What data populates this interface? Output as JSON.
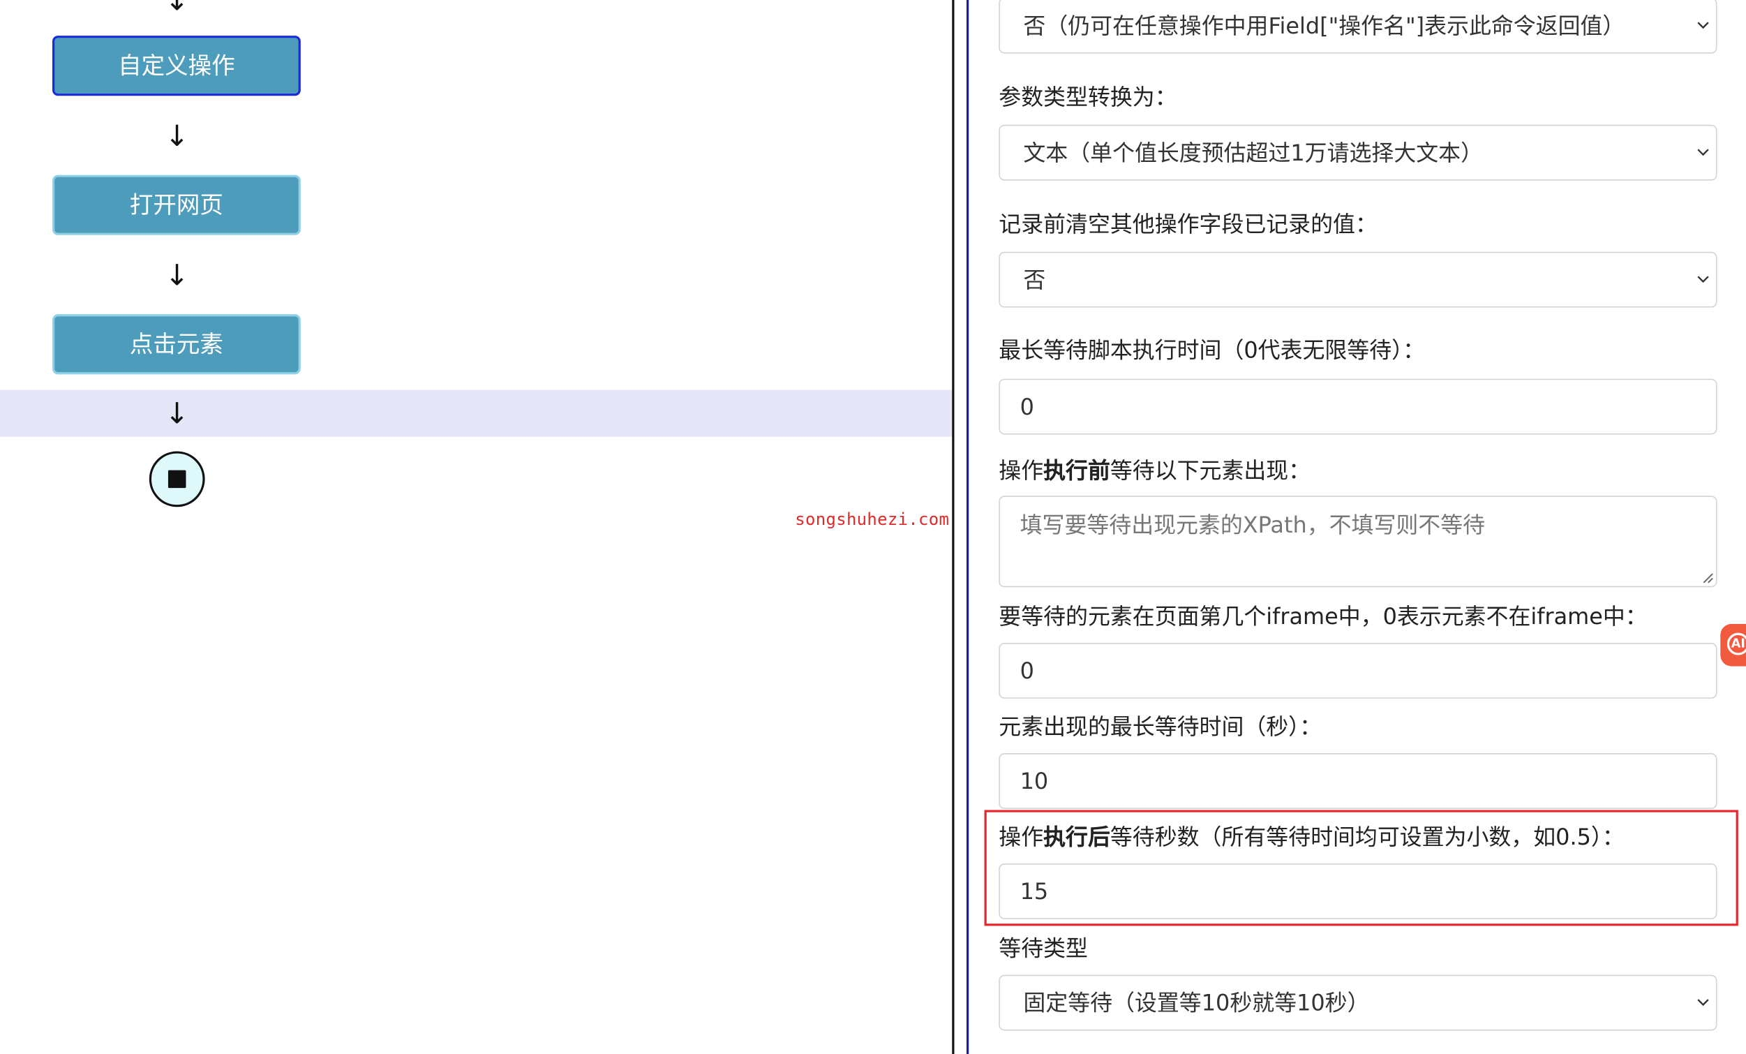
{
  "flow": {
    "arrow": "↓",
    "steps": [
      "自定义操作",
      "打开网页",
      "点击元素"
    ]
  },
  "watermark": "songshuhezi.com",
  "settings": {
    "return_select_value": "否（仍可在任意操作中用Field[\"操作名\"]表示此命令返回值）",
    "param_type_label": "参数类型转换为：",
    "param_type_value": "文本（单个值长度预估超过1万请选择大文本）",
    "clear_label": "记录前清空其他操作字段已记录的值：",
    "clear_value": "否",
    "max_script_wait_label": "最长等待脚本执行时间（0代表无限等待）：",
    "max_script_wait_value": "0",
    "before_label_prefix": "操作",
    "before_label_bold": "执行前",
    "before_label_suffix": "等待以下元素出现：",
    "xpath_placeholder": "填写要等待出现元素的XPath，不填写则不等待",
    "iframe_label": "要等待的元素在页面第几个iframe中，0表示元素不在iframe中：",
    "iframe_value": "0",
    "max_element_wait_label": "元素出现的最长等待时间（秒）：",
    "max_element_wait_value": "10",
    "after_label_prefix": "操作",
    "after_label_bold": "执行后",
    "after_label_suffix": "等待秒数（所有等待时间均可设置为小数，如0.5）：",
    "after_wait_value": "15",
    "wait_type_label": "等待类型",
    "wait_type_value": "固定等待（设置等10秒就等10秒）"
  },
  "side_badge_text": "AI",
  "colors": {
    "flow_box": "#4e9cbb",
    "selected_border": "#1b2bd9",
    "highlight": "#e5e6f7",
    "end_node_fill": "#dff9fb",
    "watermark": "#e02a2a",
    "red_box": "#e8252a",
    "side_badge": "#f15a3e"
  }
}
